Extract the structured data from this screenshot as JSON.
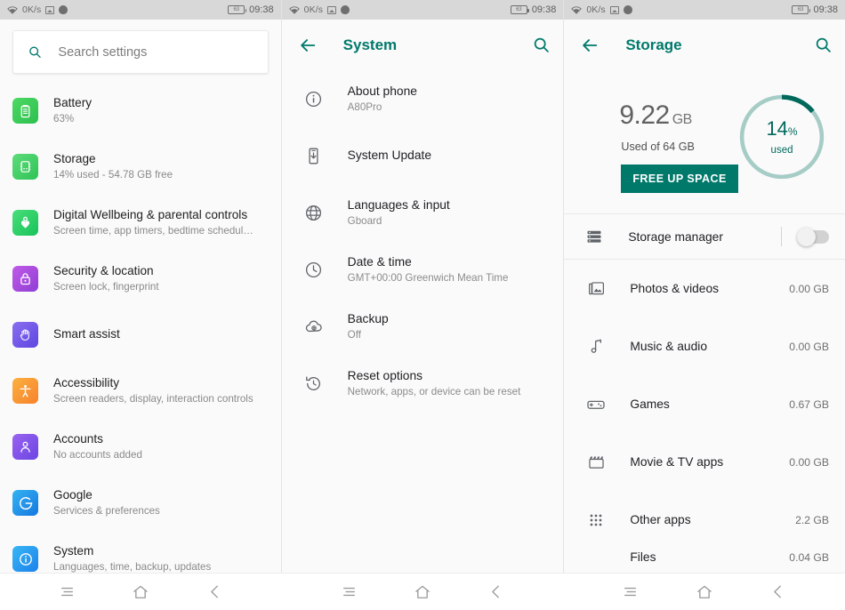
{
  "statusbar": {
    "network_speed": "0K/s",
    "battery_level": "63",
    "time": "09:38",
    "icons": [
      "wifi-icon",
      "image-icon",
      "dot-icon",
      "battery-icon"
    ]
  },
  "settings_panel": {
    "search": {
      "placeholder": "Search settings",
      "value": "",
      "icon": "search-icon"
    },
    "items": [
      {
        "title": "Battery",
        "subtitle": "63%",
        "icon": "battery-icon",
        "color_start": "#4cd964",
        "color_end": "#35c759"
      },
      {
        "title": "Storage",
        "subtitle": "14% used - 54.78 GB free",
        "icon": "storage-chip-icon",
        "color_start": "#5ddc7a",
        "color_end": "#2fc357"
      },
      {
        "title": "Digital Wellbeing & parental controls",
        "subtitle": "Screen time, app timers, bedtime schedul…",
        "icon": "wellbeing-heart-icon",
        "color_start": "#4ade7a",
        "color_end": "#18c25a"
      },
      {
        "title": "Security & location",
        "subtitle": "Screen lock, fingerprint",
        "icon": "lock-icon",
        "color_start": "#c159e8",
        "color_end": "#8e3fd4"
      },
      {
        "title": "Smart assist",
        "subtitle": "",
        "icon": "hand-icon",
        "color_start": "#8a6ef0",
        "color_end": "#5e46e0"
      },
      {
        "title": "Accessibility",
        "subtitle": "Screen readers, display, interaction controls",
        "icon": "accessibility-icon",
        "color_start": "#fbb040",
        "color_end": "#f7822c"
      },
      {
        "title": "Accounts",
        "subtitle": "No accounts added",
        "icon": "person-icon",
        "color_start": "#9a64f0",
        "color_end": "#6b45e2"
      },
      {
        "title": "Google",
        "subtitle": "Services & preferences",
        "icon": "google-g-icon",
        "color_start": "#35b3f2",
        "color_end": "#1577e0"
      },
      {
        "title": "System",
        "subtitle": "Languages, time, backup, updates",
        "icon": "info-icon",
        "color_start": "#38b6f5",
        "color_end": "#1b82ea"
      }
    ]
  },
  "system_panel": {
    "title": "System",
    "back_icon": "back-arrow-icon",
    "search_icon": "search-icon",
    "items": [
      {
        "title": "About phone",
        "subtitle": "A80Pro",
        "icon": "info-circle-icon"
      },
      {
        "title": "System Update",
        "subtitle": "",
        "icon": "system-update-icon"
      },
      {
        "title": "Languages & input",
        "subtitle": "Gboard",
        "icon": "globe-icon"
      },
      {
        "title": "Date & time",
        "subtitle": "GMT+00:00 Greenwich Mean Time",
        "icon": "clock-icon"
      },
      {
        "title": "Backup",
        "subtitle": "Off",
        "icon": "cloud-upload-icon"
      },
      {
        "title": "Reset options",
        "subtitle": "Network, apps, or device can be reset",
        "icon": "restore-icon"
      }
    ]
  },
  "storage_panel": {
    "title": "Storage",
    "back_icon": "back-arrow-icon",
    "search_icon": "search-icon",
    "used_value": "9.22",
    "used_unit": "GB",
    "used_of_label": "Used of 64 GB",
    "free_up_button": "FREE UP SPACE",
    "donut": {
      "percent": "14",
      "percent_symbol": "%",
      "caption": "used",
      "track_color": "#a6ccc6",
      "fill_color": "#00695c",
      "value": 14
    },
    "storage_manager": {
      "label": "Storage manager",
      "icon": "storage-manager-icon",
      "toggle_on": false
    },
    "categories": [
      {
        "name": "Photos & videos",
        "size": "0.00 GB",
        "icon": "photos-icon",
        "fill_percent": 0
      },
      {
        "name": "Music & audio",
        "size": "0.00 GB",
        "icon": "music-note-icon",
        "fill_percent": 0
      },
      {
        "name": "Games",
        "size": "0.67 GB",
        "icon": "gamepad-icon",
        "fill_percent": 1
      },
      {
        "name": "Movie & TV apps",
        "size": "0.00 GB",
        "icon": "clapperboard-icon",
        "fill_percent": 0
      },
      {
        "name": "Other apps",
        "size": "2.2 GB",
        "icon": "apps-grid-icon",
        "fill_percent": 3.5
      },
      {
        "name": "Files",
        "size": "0.04 GB",
        "icon": "file-icon",
        "fill_percent": 0
      }
    ]
  },
  "navbar": {
    "buttons": [
      {
        "name": "recents-button",
        "icon": "menu-icon"
      },
      {
        "name": "home-button",
        "icon": "home-icon"
      },
      {
        "name": "back-button",
        "icon": "chevron-left-icon"
      }
    ]
  }
}
